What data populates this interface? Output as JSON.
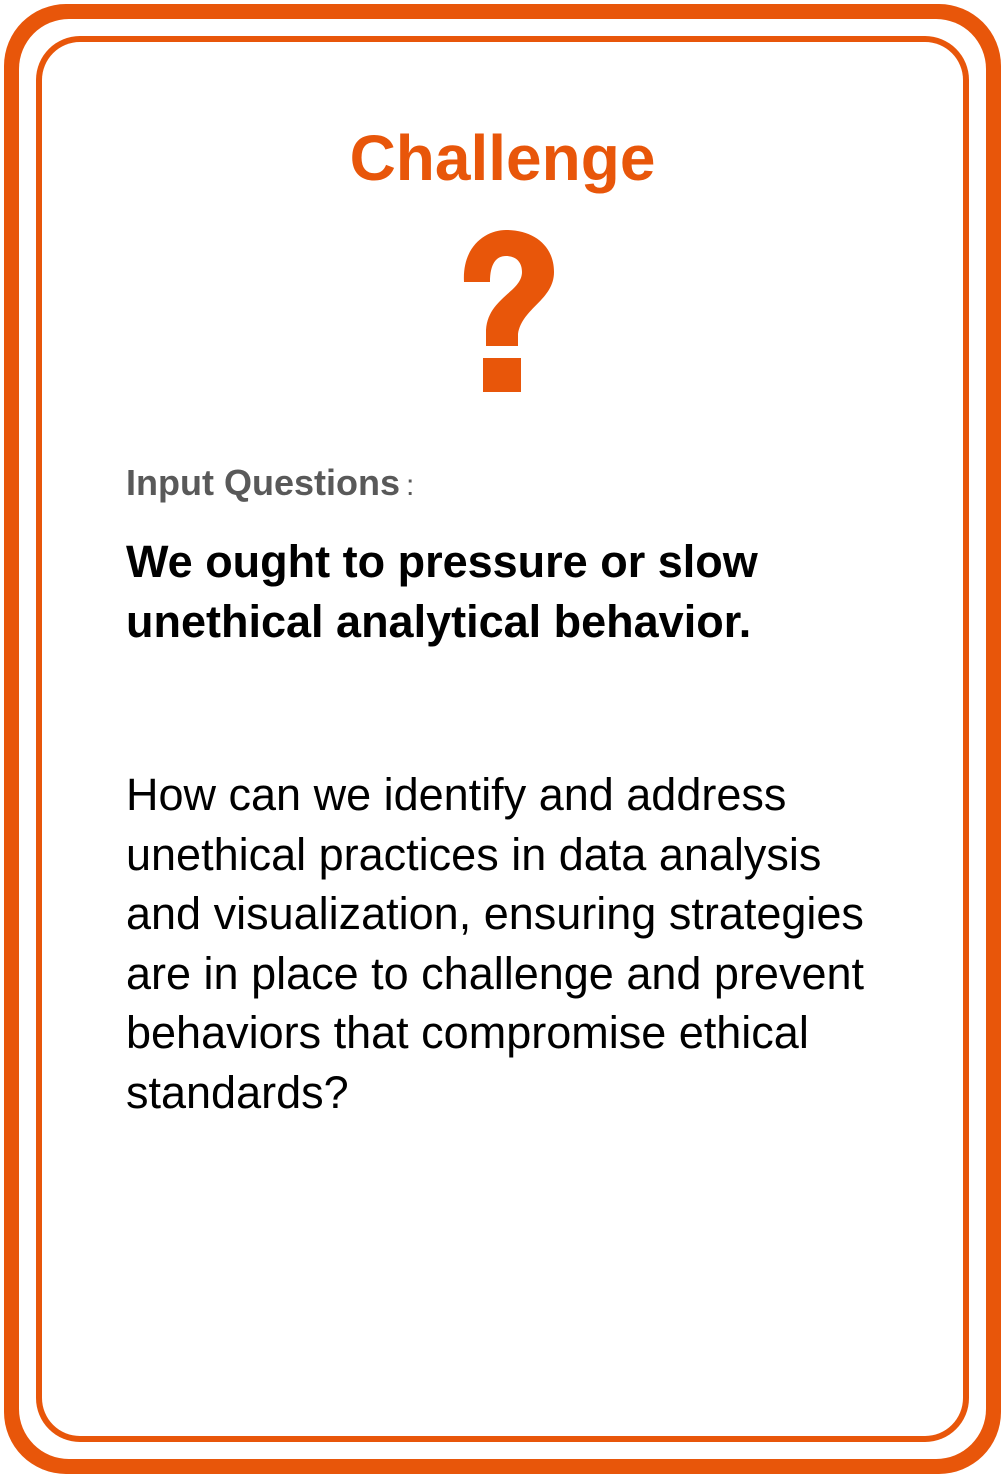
{
  "card": {
    "title": "Challenge",
    "icon": "question-mark-icon",
    "accent_color": "#e8560a",
    "label": "Input Questions",
    "label_colon": ":",
    "statement": "We ought to pressure or slow unethical analytical behavior.",
    "question": "How can we identify and address unethical practices in data analysis and visualization, ensuring strategies are in place to challenge and prevent behaviors that compromise ethical standards?"
  }
}
